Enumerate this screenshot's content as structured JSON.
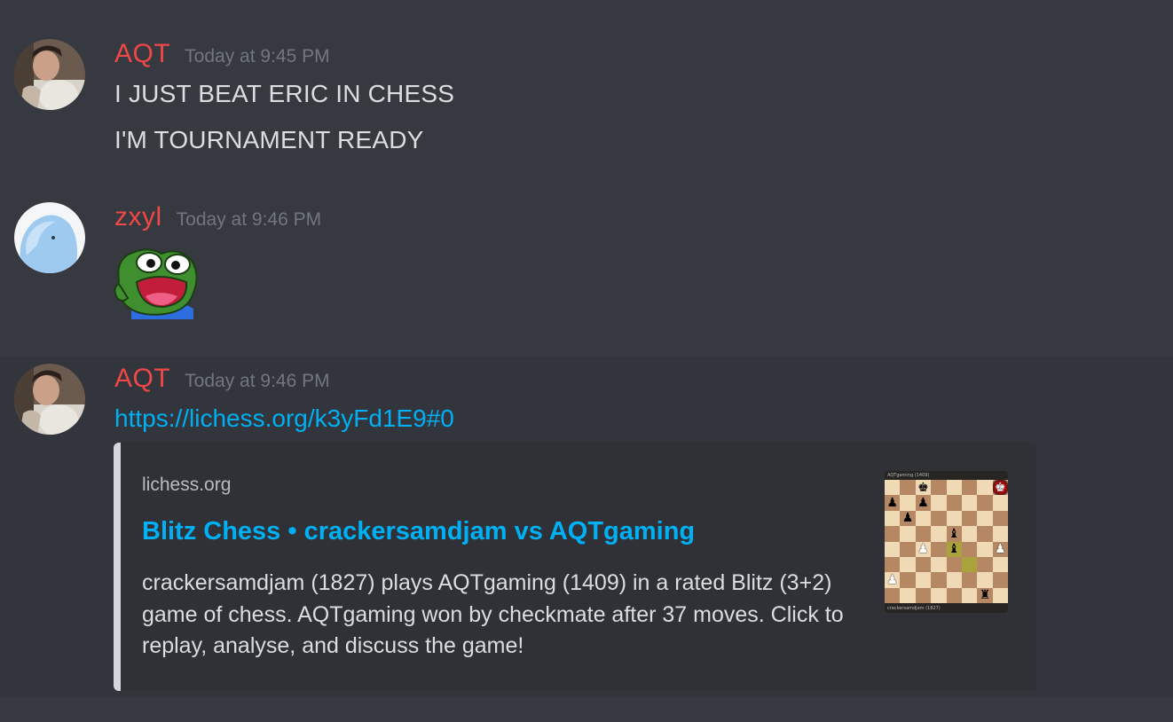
{
  "messages": [
    {
      "username": "AQT",
      "timestamp": "Today at 9:45 PM",
      "lines": [
        "I JUST BEAT ERIC IN CHESS",
        "I'M TOURNAMENT READY"
      ]
    },
    {
      "username": "zxyl",
      "timestamp": "Today at 9:46 PM",
      "emoji": "poggers-frog-emoji"
    },
    {
      "username": "AQT",
      "timestamp": "Today at 9:46 PM",
      "link": "https://lichess.org/k3yFd1E9#0",
      "embed": {
        "provider": "lichess.org",
        "title": "Blitz Chess • crackersamdjam vs AQTgaming",
        "description": "crackersamdjam (1827) plays AQTgaming (1409) in a rated Blitz (3+2) game of chess. AQTgaming won by checkmate after 37 moves. Click to replay, analyse, and discuss the game!",
        "thumbnail": {
          "top_player": "AQTgaming (1409)",
          "bottom_player": "crackersamdjam (1827)",
          "position_rows": [
            "..k....K",
            "p.p.....",
            ".p......",
            "....b...",
            "..P.b..P",
            "........",
            "P.......",
            "......r."
          ],
          "highlight_squares": [
            "e4",
            "f3"
          ],
          "check_square": "h8"
        }
      }
    }
  ],
  "colors": {
    "background": "#36393f",
    "username": "#f04747",
    "link": "#00b0f4",
    "embed_bg": "#2f3136"
  }
}
